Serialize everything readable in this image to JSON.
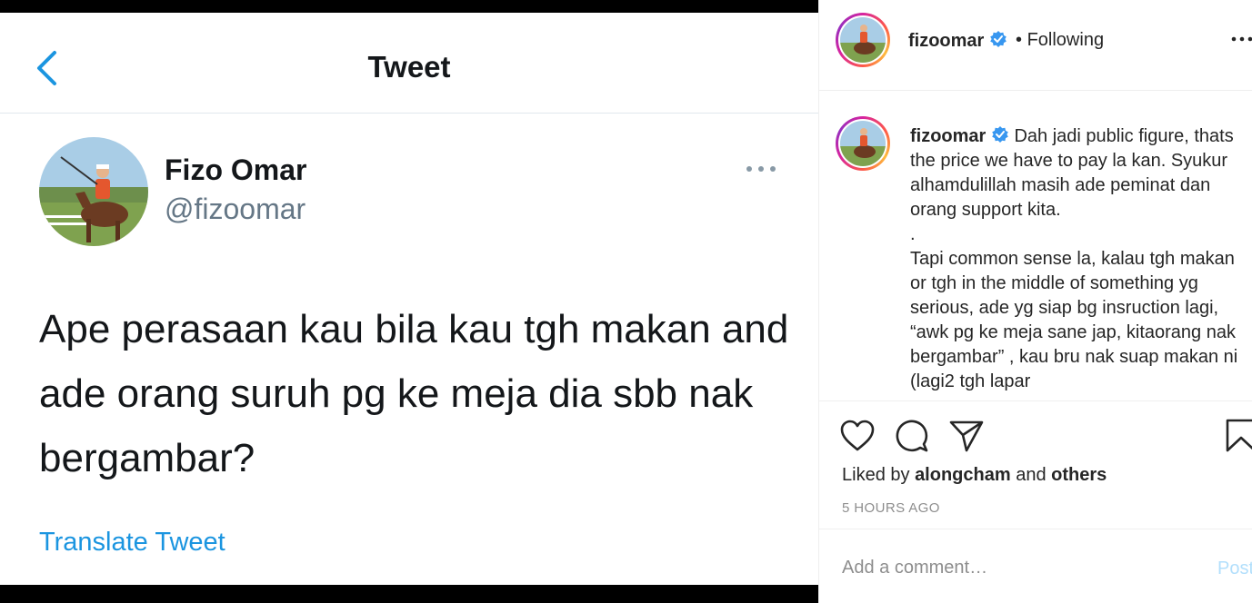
{
  "tweet": {
    "header_title": "Tweet",
    "author_name": "Fizo Omar",
    "author_handle": "@fizoomar",
    "body": "Ape perasaan kau bila kau tgh makan and ade orang suruh pg ke meja dia sbb nak bergambar?",
    "translate_label": "Translate Tweet",
    "icons": [
      "back-chevron-icon",
      "more-options-icon"
    ],
    "accent_color": "#1b95e0"
  },
  "instagram": {
    "header": {
      "username": "fizoomar",
      "separator": "•",
      "follow_status": "Following"
    },
    "caption": {
      "username": "fizoomar",
      "text": "Dah jadi public figure, thats the price we have to pay la kan. Syukur alhamdulillah masih ade peminat dan orang support kita.\n.\nTapi common sense la, kalau tgh makan or tgh in the middle of something yg serious, ade yg siap bg insruction lagi, “awk pg ke meja sane jap, kitaorang nak bergambar” , kau bru nak suap makan ni (lagi2 tgh lapar"
    },
    "likes": {
      "prefix": "Liked by",
      "user": "alongcham",
      "conjunction": "and",
      "others": "others"
    },
    "timestamp": "5 HOURS AGO",
    "comment": {
      "placeholder": "Add a comment…",
      "post_label": "Post"
    },
    "icons": [
      "heart-icon",
      "comment-icon",
      "share-icon",
      "bookmark-icon",
      "verified-icon",
      "more-options-icon"
    ],
    "verified_color": "#3897f0"
  }
}
